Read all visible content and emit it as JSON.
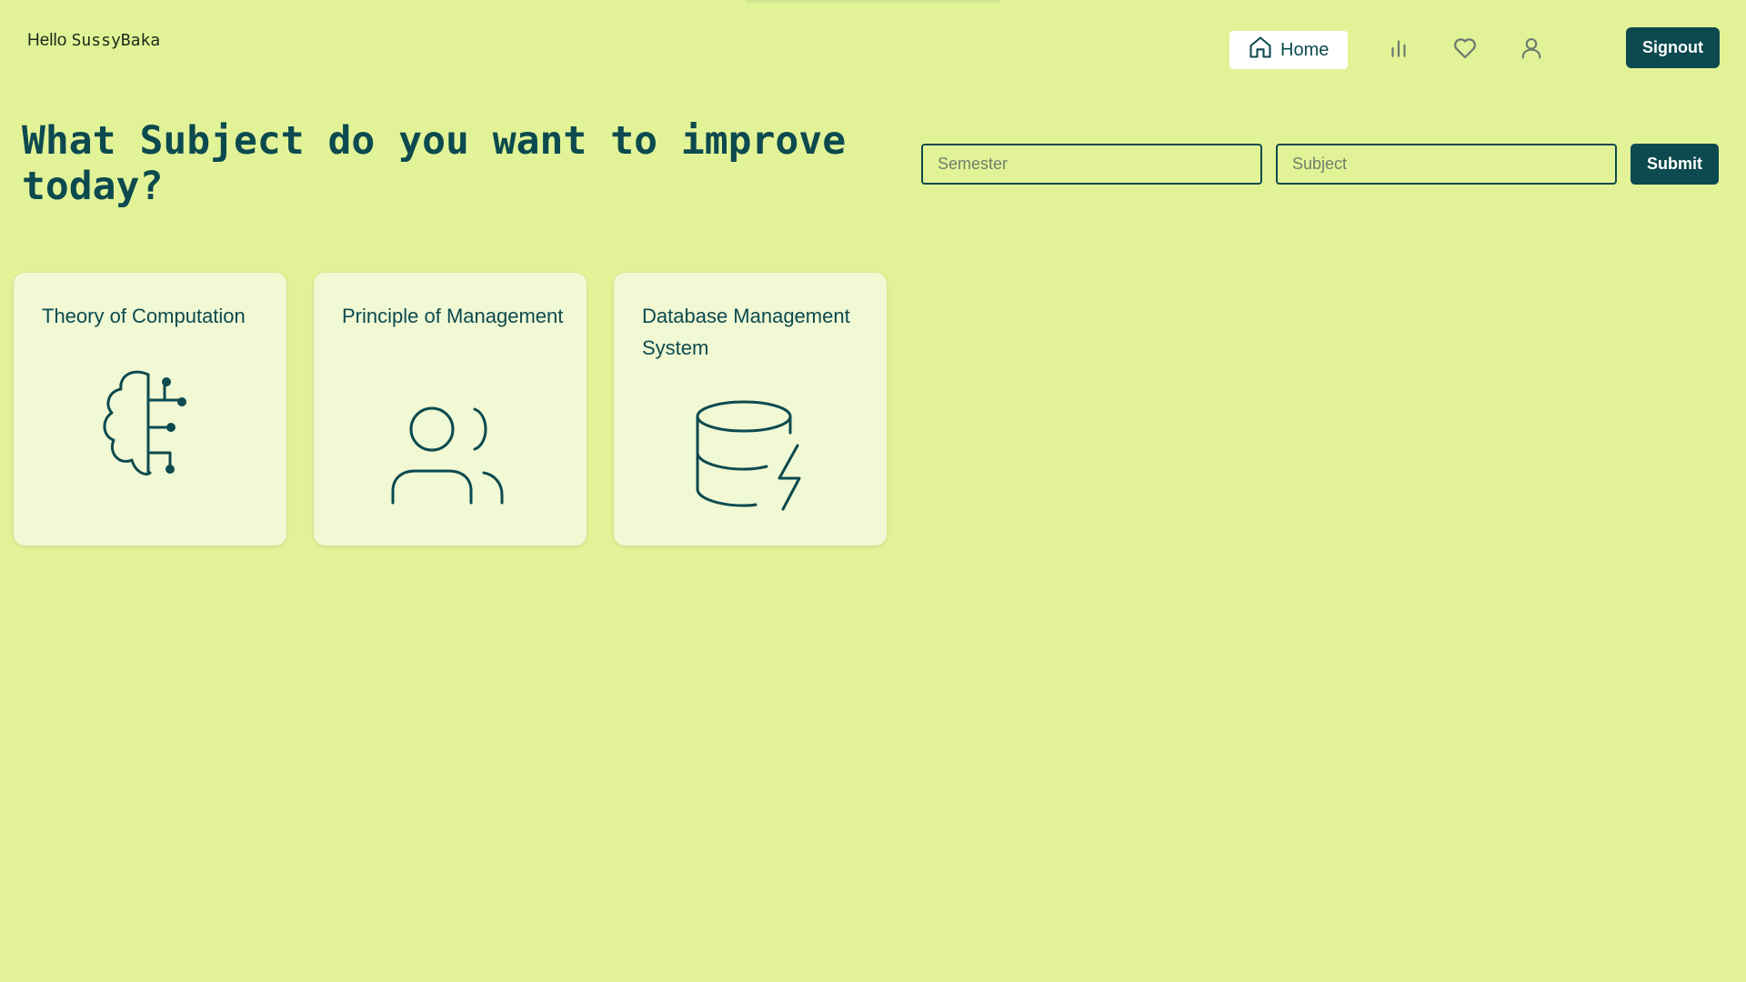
{
  "header": {
    "greeting_prefix": "Hello",
    "username": "SussyBaka",
    "nav": {
      "home_label": "Home",
      "icons": [
        "home-icon",
        "bar-chart-icon",
        "heart-icon",
        "user-icon"
      ]
    },
    "signout_label": "Signout"
  },
  "main": {
    "heading": "What Subject do you want to improve today?",
    "form": {
      "semester_placeholder": "Semester",
      "subject_placeholder": "Subject",
      "submit_label": "Submit"
    },
    "subjects": [
      {
        "title": "Theory of Computation",
        "icon": "brain-circuit-icon"
      },
      {
        "title": "Principle of Management",
        "icon": "users-icon"
      },
      {
        "title": "Database Management System",
        "icon": "database-zap-icon"
      }
    ]
  },
  "colors": {
    "background": "#e2f397",
    "primary": "#0c4a4f",
    "card": "#f0f8d4",
    "nav_active_bg": "#ffffff"
  }
}
